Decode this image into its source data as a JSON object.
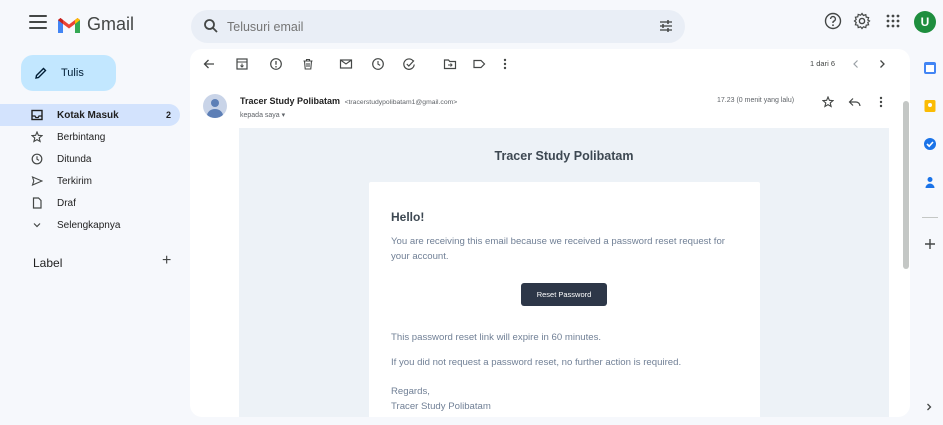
{
  "app": {
    "name": "Gmail"
  },
  "search": {
    "placeholder": "Telusuri email"
  },
  "compose": {
    "label": "Tulis"
  },
  "sidebar": {
    "items": [
      {
        "label": "Kotak Masuk",
        "count": "2",
        "icon": "inbox-icon"
      },
      {
        "label": "Berbintang",
        "count": "",
        "icon": "star-icon"
      },
      {
        "label": "Ditunda",
        "count": "",
        "icon": "clock-icon"
      },
      {
        "label": "Terkirim",
        "count": "",
        "icon": "send-icon"
      },
      {
        "label": "Draf",
        "count": "",
        "icon": "draft-icon"
      },
      {
        "label": "Selengkapnya",
        "count": "",
        "icon": "chevron-down-icon"
      }
    ],
    "labels_heading": "Label",
    "labels_add": "+"
  },
  "user": {
    "avatar_letter": "U",
    "avatar_color": "#1e8e3e"
  },
  "toolbar": {
    "pager": "1 dari 6"
  },
  "message": {
    "sender_name": "Tracer Study Polibatam",
    "sender_email": "<tracerstudypolibatam1@gmail.com>",
    "recipient": "kepada saya",
    "time": "17.23 (0 menit yang lalu)"
  },
  "email_body": {
    "header_title": "Tracer Study Polibatam",
    "greeting": "Hello!",
    "intro": "You are receiving this email because we received a password reset request for your account.",
    "button_label": "Reset Password",
    "expire": "This password reset link will expire in 60 minutes.",
    "no_action": "If you did not request a password reset, no further action is required.",
    "regards": "Regards,",
    "signature": "Tracer Study Polibatam"
  },
  "colors": {
    "accent": "#c2e7ff",
    "active_nav": "#d3e3fd",
    "button": "#2d3748"
  }
}
